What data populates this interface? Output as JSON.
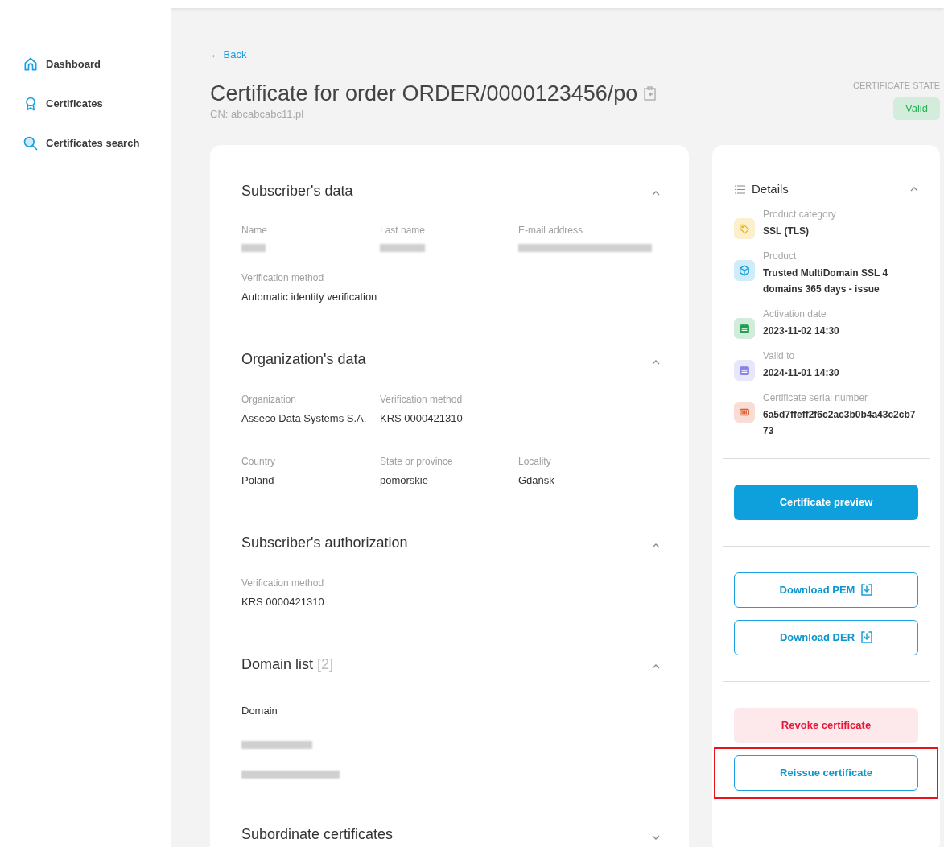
{
  "sidebar": {
    "items": [
      {
        "label": "Dashboard"
      },
      {
        "label": "Certificates"
      },
      {
        "label": "Certificates search"
      }
    ]
  },
  "back": "← Back",
  "title": "Certificate for order ORDER/0000123456/po",
  "cn": "CN: abcabcabc11.pl",
  "state": {
    "label": "CERTIFICATE STATE",
    "value": "Valid"
  },
  "sections": [
    {
      "title": "Subscriber's data",
      "expanded": true,
      "groups": [
        [
          {
            "label": "Name",
            "redacted": true
          },
          {
            "label": "Last name",
            "redacted": true
          },
          {
            "label": "E-mail address",
            "redacted": true
          }
        ],
        [
          {
            "label": "Verification method",
            "value": "Automatic identity verification"
          }
        ]
      ]
    },
    {
      "title": "Organization's data",
      "expanded": true,
      "divided": true,
      "groups": [
        [
          {
            "label": "Organization",
            "value": "Asseco Data Systems S.A."
          },
          {
            "label": "Verification method",
            "value": "KRS 0000421310"
          }
        ],
        [
          {
            "label": "Country",
            "value": "Poland"
          },
          {
            "label": "State or province",
            "value": "pomorskie"
          },
          {
            "label": "Locality",
            "value": "Gdańsk"
          }
        ]
      ]
    },
    {
      "title": "Subscriber's authorization",
      "expanded": true,
      "groups": [
        [
          {
            "label": "Verification method",
            "value": "KRS 0000421310"
          }
        ]
      ]
    },
    {
      "title": "Domain list",
      "count": "[2]",
      "expanded": true,
      "list": {
        "heading": "Domain",
        "items": [
          {
            "redacted": true
          },
          {
            "redacted": true
          }
        ]
      }
    },
    {
      "title": "Subordinate certificates",
      "expanded": false
    }
  ],
  "details": {
    "title": "Details",
    "expanded": true,
    "items": [
      {
        "kind": "tag",
        "color": "#f0b400",
        "label": "Product category",
        "value": "SSL (TLS)"
      },
      {
        "kind": "cube",
        "color": "#1aa0e0",
        "label": "Product",
        "value": "Trusted MultiDomain SSL 4 domains 365 days - issue"
      },
      {
        "kind": "calendar",
        "color": "#20a050",
        "label": "Activation date",
        "value": "2023-11-02 14:30"
      },
      {
        "kind": "calendar",
        "color": "#8a84e8",
        "label": "Valid to",
        "value": "2024-11-01 14:30"
      },
      {
        "kind": "barcode",
        "color": "#e0572a",
        "label": "Certificate serial number",
        "value": "6a5d7ffeff2f6c2ac3b0b4a43c2cb773"
      }
    ]
  },
  "actions": [
    [
      {
        "kind": "primary",
        "label": "Certificate preview",
        "highlighted": false
      }
    ],
    [
      {
        "kind": "download",
        "label": "Download PEM",
        "highlighted": false
      },
      {
        "kind": "download",
        "label": "Download DER",
        "highlighted": false
      }
    ],
    [
      {
        "kind": "danger",
        "label": "Revoke certificate",
        "highlighted": false
      },
      {
        "kind": "outline",
        "label": "Reissue certificate",
        "highlighted": true
      }
    ]
  ]
}
